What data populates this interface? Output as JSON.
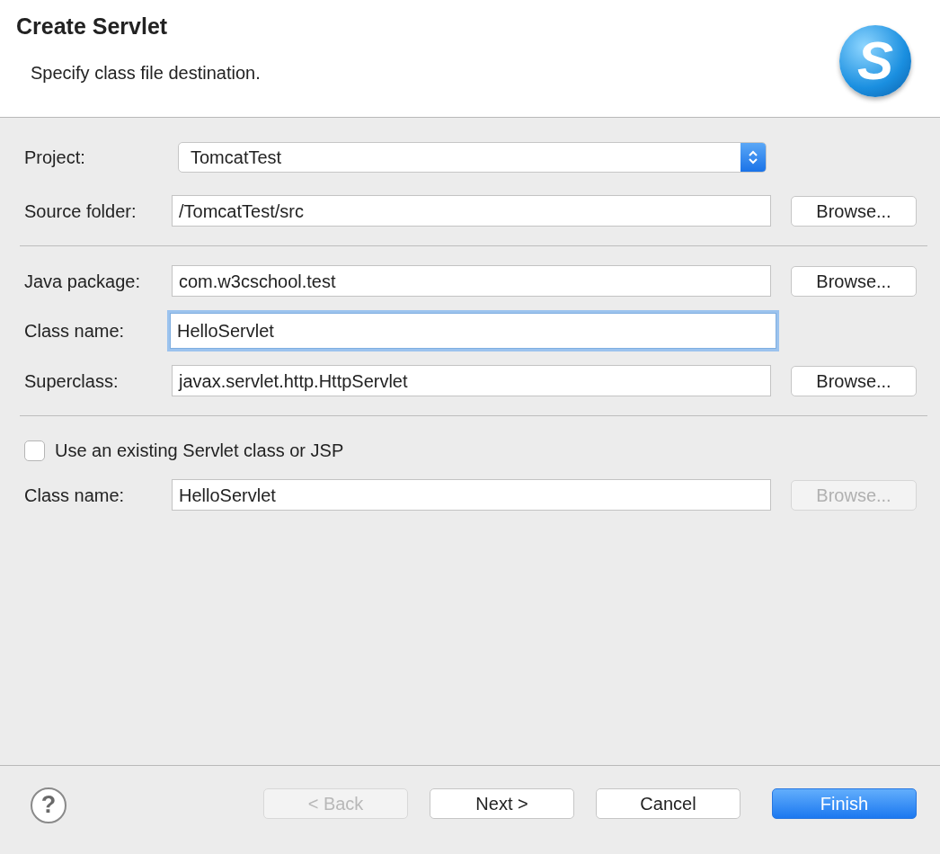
{
  "dialog": {
    "title": "Create Servlet",
    "subtitle": "Specify class file destination.",
    "logo": "S"
  },
  "sections": [
    {
      "rows": [
        {
          "kind": "select",
          "label": "Project:",
          "value": "TomcatTest",
          "focused": false
        },
        {
          "kind": "text",
          "label": "Source folder:",
          "value": "/TomcatTest/src",
          "focused": false,
          "browse": {
            "label": "Browse...",
            "disabled": false
          }
        }
      ]
    },
    {
      "rows": [
        {
          "kind": "text",
          "label": "Java package:",
          "value": "com.w3cschool.test",
          "focused": false,
          "browse": {
            "label": "Browse...",
            "disabled": false
          }
        },
        {
          "kind": "text",
          "label": "Class name:",
          "value": "HelloServlet",
          "focused": true
        },
        {
          "kind": "text",
          "label": "Superclass:",
          "value": "javax.servlet.http.HttpServlet",
          "focused": false,
          "browse": {
            "label": "Browse...",
            "disabled": false
          }
        }
      ]
    },
    {
      "rows": [
        {
          "kind": "checkbox",
          "label": "Use an existing Servlet class or JSP",
          "checked": false
        },
        {
          "kind": "text",
          "label": "Class name:",
          "value": "HelloServlet",
          "focused": false,
          "browse": {
            "label": "Browse...",
            "disabled": true
          }
        }
      ]
    }
  ],
  "footer": {
    "help": "?",
    "buttons": [
      {
        "label": "< Back",
        "disabled": true,
        "primary": false
      },
      {
        "label": "Next >",
        "disabled": false,
        "primary": false
      },
      {
        "label": "Cancel",
        "disabled": false,
        "primary": false
      },
      {
        "label": "Finish",
        "disabled": false,
        "primary": true
      }
    ]
  }
}
